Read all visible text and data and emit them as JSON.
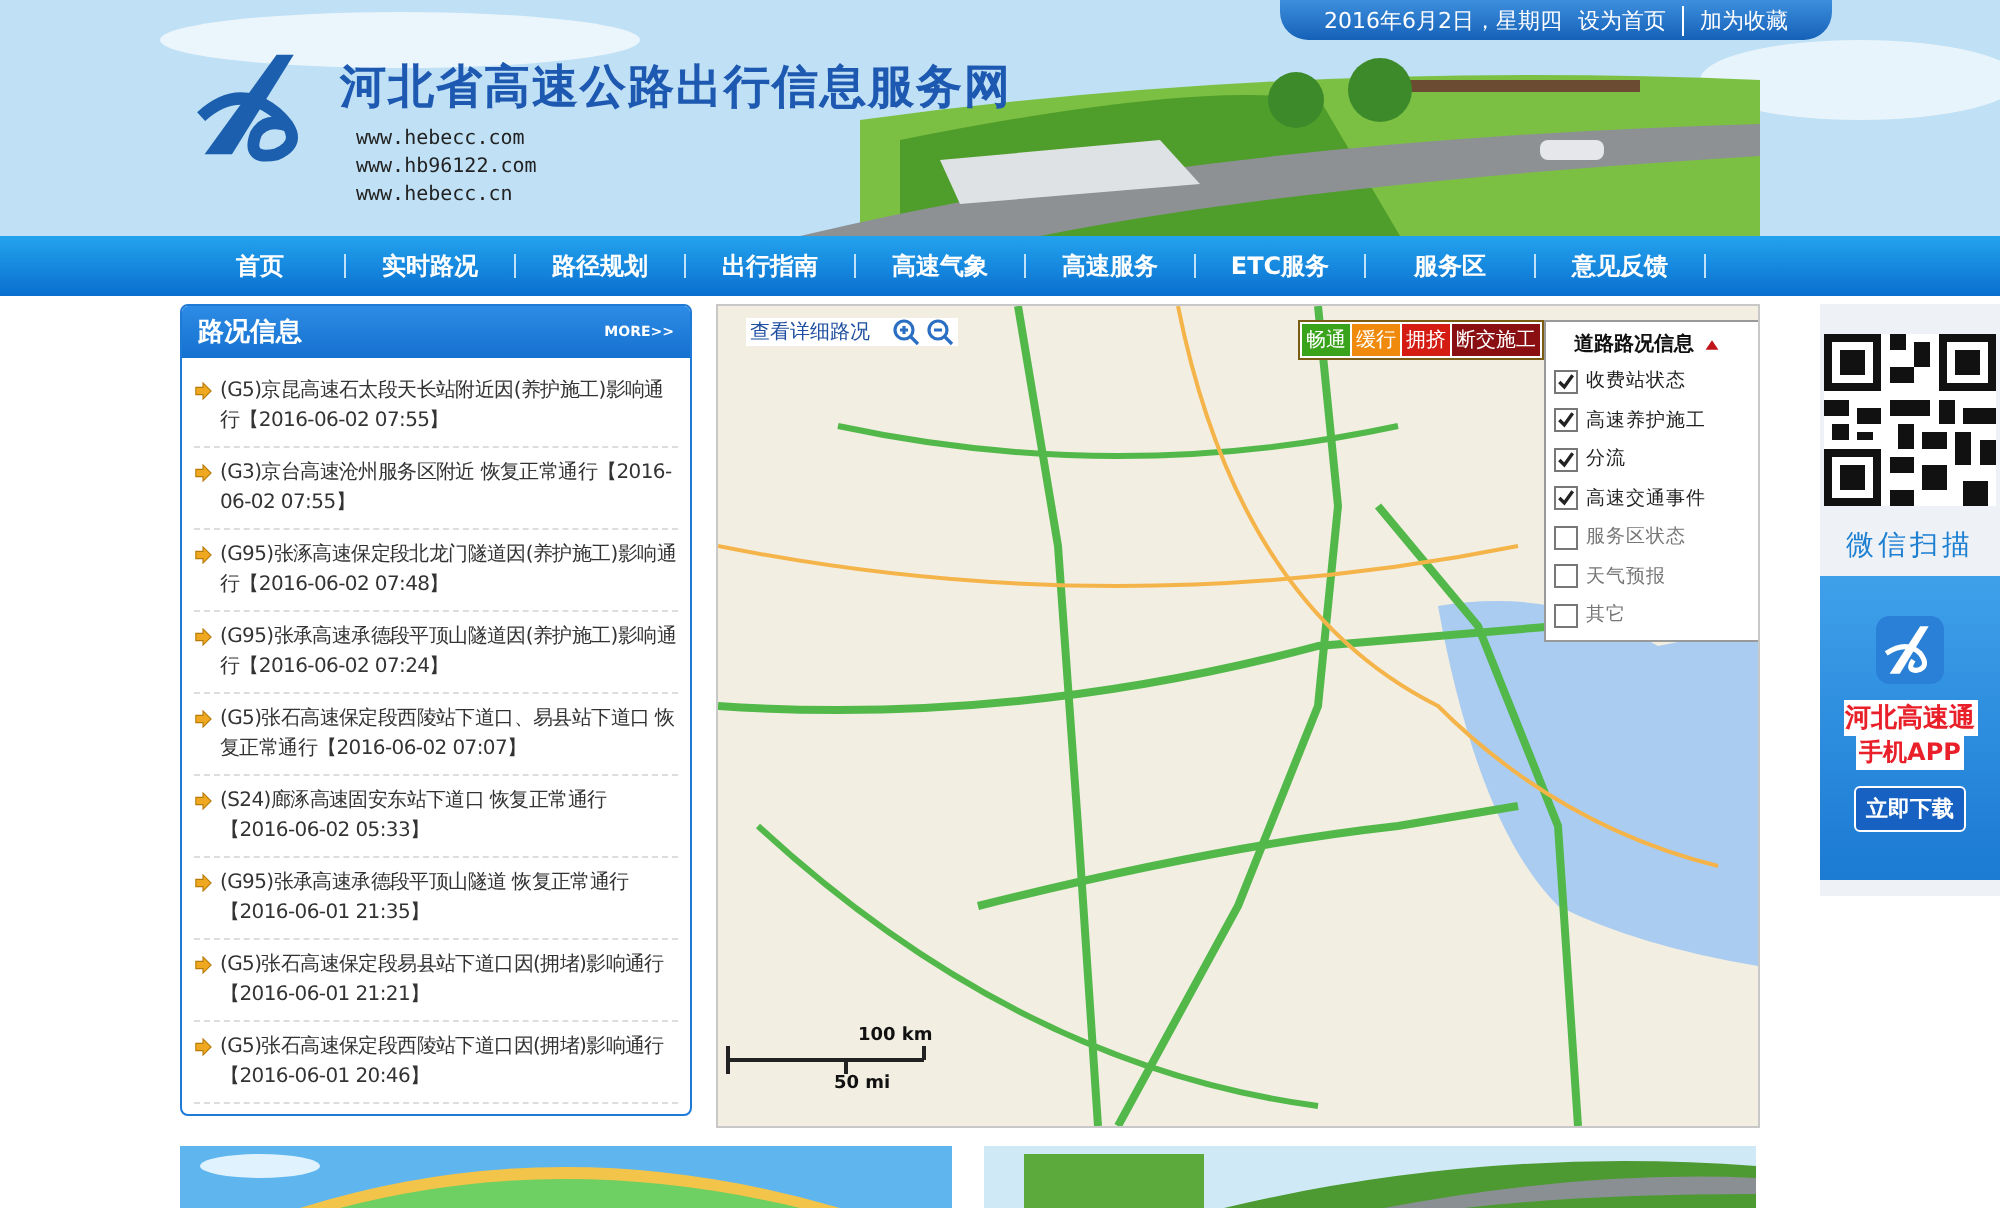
{
  "header": {
    "date_text": "2016年6月2日，星期四",
    "links": [
      "设为首页",
      "加为收藏"
    ],
    "site_title": "河北省高速公路出行信息服务网",
    "urls": [
      "www.hebecc.com",
      "www.hb96122.com",
      "www.hebecc.cn"
    ]
  },
  "nav": [
    {
      "label": "首页",
      "selected": false
    },
    {
      "label": "实时路况",
      "selected": false
    },
    {
      "label": "路径规划",
      "selected": false
    },
    {
      "label": "出行指南",
      "selected": false
    },
    {
      "label": "高速气象",
      "selected": false
    },
    {
      "label": "高速服务",
      "selected": false
    },
    {
      "label": "ETC服务",
      "selected": false
    },
    {
      "label": "服务区",
      "selected": false
    },
    {
      "label": "意见反馈",
      "selected": false
    }
  ],
  "news": {
    "title": "路况信息",
    "more": "MORE>>",
    "items": [
      "(G5)京昆高速石太段天长站附近因(养护施工)影响通行【2016-06-02 07:55】",
      "(G3)京台高速沧州服务区附近 恢复正常通行【2016-06-02 07:55】",
      "(G95)张涿高速保定段北龙门隧道因(养护施工)影响通行【2016-06-02 07:48】",
      "(G95)张承高速承德段平顶山隧道因(养护施工)影响通行【2016-06-02 07:24】",
      "(G5)张石高速保定段西陵站下道口、易县站下道口 恢复正常通行【2016-06-02 07:07】",
      "(S24)廊涿高速固安东站下道口 恢复正常通行【2016-06-02 05:33】",
      "(G95)张承高速承德段平顶山隧道 恢复正常通行【2016-06-01 21:35】",
      "(G5)张石高速保定段易县站下道口因(拥堵)影响通行【2016-06-01 21:21】",
      "(G5)张石高速保定段西陵站下道口因(拥堵)影响通行【2016-06-01 20:46】"
    ]
  },
  "map": {
    "detail_link": "查看详细路况",
    "legend": [
      {
        "label": "畅通",
        "color": "#3aa31c"
      },
      {
        "label": "缓行",
        "color": "#f08a0c"
      },
      {
        "label": "拥挤",
        "color": "#d41c12"
      },
      {
        "label": "断交施工",
        "color": "#8a0f12"
      }
    ],
    "layers": {
      "title": "道路路况信息",
      "expanded": true,
      "items": [
        {
          "label": "收费站状态",
          "checked": true
        },
        {
          "label": "高速养护施工",
          "checked": true
        },
        {
          "label": "分流",
          "checked": true
        },
        {
          "label": "高速交通事件",
          "checked": true
        },
        {
          "label": "服务区状态",
          "checked": false
        },
        {
          "label": "天气预报",
          "checked": false
        },
        {
          "label": "其它",
          "checked": false
        }
      ]
    },
    "scale": [
      "100 km",
      "50 mi"
    ]
  },
  "side": {
    "qr_caption": "微信扫描",
    "app_name": "河北高速通",
    "app_sub": "手机APP",
    "download": "立即下载"
  }
}
